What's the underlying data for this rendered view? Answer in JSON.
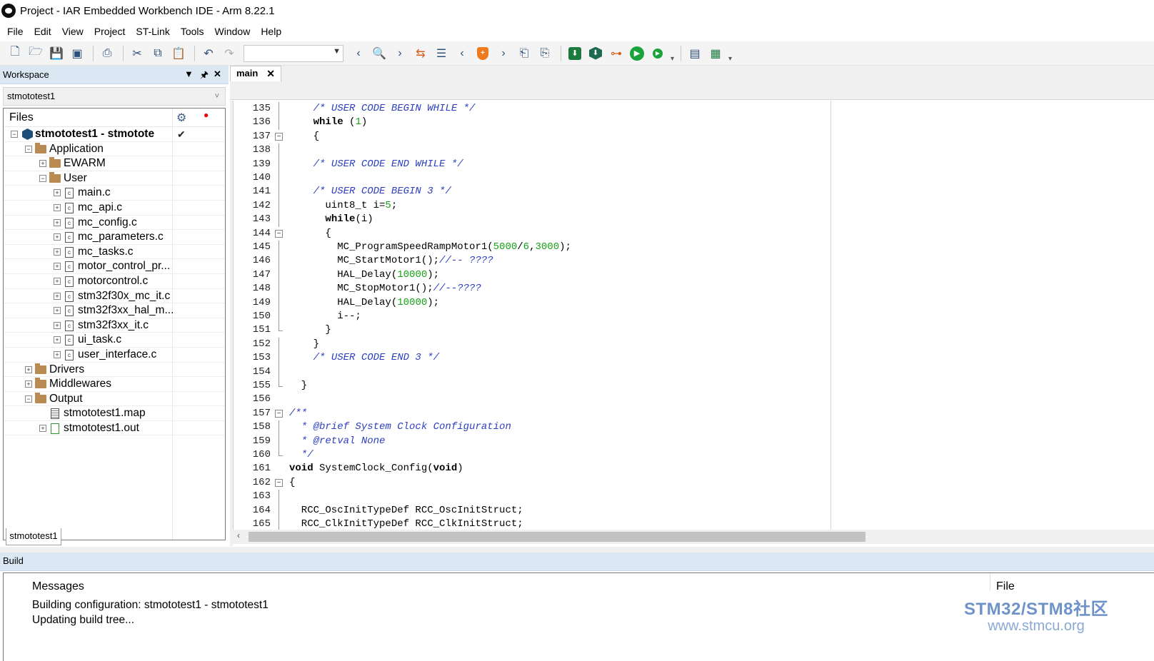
{
  "window": {
    "title": "Project - IAR Embedded Workbench IDE - Arm 8.22.1"
  },
  "menu": [
    "File",
    "Edit",
    "View",
    "Project",
    "ST-Link",
    "Tools",
    "Window",
    "Help"
  ],
  "workspace": {
    "header": "Workspace",
    "config": "stmototest1",
    "files_label": "Files",
    "tab": "stmototest1",
    "tree": [
      {
        "label": "stmototest1 - stmotote",
        "type": "project",
        "level": 0,
        "expander": "−",
        "bold": true
      },
      {
        "label": "Application",
        "type": "folder",
        "level": 1,
        "expander": "−"
      },
      {
        "label": "EWARM",
        "type": "folder",
        "level": 2,
        "expander": "+"
      },
      {
        "label": "User",
        "type": "folder",
        "level": 2,
        "expander": "−"
      },
      {
        "label": "main.c",
        "type": "c",
        "level": 3,
        "expander": "+"
      },
      {
        "label": "mc_api.c",
        "type": "c",
        "level": 3,
        "expander": "+"
      },
      {
        "label": "mc_config.c",
        "type": "c",
        "level": 3,
        "expander": "+"
      },
      {
        "label": "mc_parameters.c",
        "type": "c",
        "level": 3,
        "expander": "+"
      },
      {
        "label": "mc_tasks.c",
        "type": "c",
        "level": 3,
        "expander": "+"
      },
      {
        "label": "motor_control_pr...",
        "type": "c",
        "level": 3,
        "expander": "+"
      },
      {
        "label": "motorcontrol.c",
        "type": "c",
        "level": 3,
        "expander": "+"
      },
      {
        "label": "stm32f30x_mc_it.c",
        "type": "c",
        "level": 3,
        "expander": "+"
      },
      {
        "label": "stm32f3xx_hal_m...",
        "type": "c",
        "level": 3,
        "expander": "+"
      },
      {
        "label": "stm32f3xx_it.c",
        "type": "c",
        "level": 3,
        "expander": "+"
      },
      {
        "label": "ui_task.c",
        "type": "c",
        "level": 3,
        "expander": "+"
      },
      {
        "label": "user_interface.c",
        "type": "c",
        "level": 3,
        "expander": "+"
      },
      {
        "label": "Drivers",
        "type": "folder",
        "level": 1,
        "expander": "+"
      },
      {
        "label": "Middlewares",
        "type": "folder",
        "level": 1,
        "expander": "+"
      },
      {
        "label": "Output",
        "type": "folder",
        "level": 1,
        "expander": "−"
      },
      {
        "label": "stmototest1.map",
        "type": "map",
        "level": 2,
        "expander": ""
      },
      {
        "label": "stmototest1.out",
        "type": "out",
        "level": 2,
        "expander": "+"
      }
    ]
  },
  "editor": {
    "tab": "main",
    "lines": [
      {
        "n": "135",
        "fold": "line",
        "segs": [
          [
            "    ",
            ""
          ],
          [
            "/* USER CODE BEGIN WHILE */",
            "cmt"
          ]
        ]
      },
      {
        "n": "136",
        "fold": "line",
        "segs": [
          [
            "    ",
            ""
          ],
          [
            "while",
            "kw"
          ],
          [
            " (",
            ""
          ],
          [
            "1",
            "num"
          ],
          [
            ")",
            ""
          ]
        ]
      },
      {
        "n": "137",
        "fold": "box",
        "segs": [
          [
            "    {",
            ""
          ]
        ]
      },
      {
        "n": "138",
        "fold": "line",
        "segs": []
      },
      {
        "n": "139",
        "fold": "line",
        "segs": [
          [
            "    ",
            ""
          ],
          [
            "/* USER CODE END WHILE */",
            "cmt"
          ]
        ]
      },
      {
        "n": "140",
        "fold": "line",
        "segs": []
      },
      {
        "n": "141",
        "fold": "line",
        "segs": [
          [
            "    ",
            ""
          ],
          [
            "/* USER CODE BEGIN 3 */",
            "cmt"
          ]
        ]
      },
      {
        "n": "142",
        "fold": "line",
        "segs": [
          [
            "      uint8_t i=",
            ""
          ],
          [
            "5",
            "num"
          ],
          [
            ";",
            ""
          ]
        ]
      },
      {
        "n": "143",
        "fold": "line",
        "segs": [
          [
            "      ",
            ""
          ],
          [
            "while",
            "kw"
          ],
          [
            "(i)",
            ""
          ]
        ]
      },
      {
        "n": "144",
        "fold": "box",
        "segs": [
          [
            "      {",
            ""
          ]
        ]
      },
      {
        "n": "145",
        "fold": "line",
        "segs": [
          [
            "        MC_ProgramSpeedRampMotor1(",
            ""
          ],
          [
            "5000",
            "num"
          ],
          [
            "/",
            ""
          ],
          [
            "6",
            "num"
          ],
          [
            ",",
            ""
          ],
          [
            "3000",
            "num"
          ],
          [
            ");",
            ""
          ]
        ]
      },
      {
        "n": "146",
        "fold": "line",
        "segs": [
          [
            "        MC_StartMotor1();",
            ""
          ],
          [
            "//-- ????",
            "cmt"
          ]
        ]
      },
      {
        "n": "147",
        "fold": "line",
        "segs": [
          [
            "        HAL_Delay(",
            ""
          ],
          [
            "10000",
            "num"
          ],
          [
            ");",
            ""
          ]
        ]
      },
      {
        "n": "148",
        "fold": "line",
        "segs": [
          [
            "        MC_StopMotor1();",
            ""
          ],
          [
            "//--????",
            "cmt"
          ]
        ]
      },
      {
        "n": "149",
        "fold": "line",
        "segs": [
          [
            "        HAL_Delay(",
            ""
          ],
          [
            "10000",
            "num"
          ],
          [
            ");",
            ""
          ]
        ]
      },
      {
        "n": "150",
        "fold": "line",
        "segs": [
          [
            "        i--;",
            ""
          ]
        ]
      },
      {
        "n": "151",
        "fold": "end",
        "segs": [
          [
            "      }",
            ""
          ]
        ]
      },
      {
        "n": "152",
        "fold": "line",
        "segs": [
          [
            "    }",
            ""
          ]
        ]
      },
      {
        "n": "153",
        "fold": "line",
        "segs": [
          [
            "    ",
            ""
          ],
          [
            "/* USER CODE END 3 */",
            "cmt"
          ]
        ]
      },
      {
        "n": "154",
        "fold": "line",
        "segs": []
      },
      {
        "n": "155",
        "fold": "end",
        "segs": [
          [
            "  }",
            ""
          ]
        ]
      },
      {
        "n": "156",
        "fold": "none",
        "segs": []
      },
      {
        "n": "157",
        "fold": "box",
        "segs": [
          [
            "/**",
            "cmt"
          ]
        ]
      },
      {
        "n": "158",
        "fold": "line",
        "segs": [
          [
            "  * @brief System Clock Configuration",
            "cmt"
          ]
        ]
      },
      {
        "n": "159",
        "fold": "line",
        "segs": [
          [
            "  * @retval None",
            "cmt"
          ]
        ]
      },
      {
        "n": "160",
        "fold": "end",
        "segs": [
          [
            "  */",
            "cmt"
          ]
        ]
      },
      {
        "n": "161",
        "fold": "none",
        "segs": [
          [
            "void",
            "kw"
          ],
          [
            " SystemClock_Config(",
            ""
          ],
          [
            "void",
            "kw"
          ],
          [
            ")",
            ""
          ]
        ]
      },
      {
        "n": "162",
        "fold": "box",
        "segs": [
          [
            "{",
            ""
          ]
        ]
      },
      {
        "n": "163",
        "fold": "line",
        "segs": []
      },
      {
        "n": "164",
        "fold": "line",
        "segs": [
          [
            "  RCC_OscInitTypeDef RCC_OscInitStruct;",
            ""
          ]
        ]
      },
      {
        "n": "165",
        "fold": "line",
        "segs": [
          [
            "  RCC_ClkInitTypeDef RCC_ClkInitStruct;",
            ""
          ]
        ]
      }
    ]
  },
  "build": {
    "header": "Build",
    "col_messages": "Messages",
    "col_file": "File",
    "messages": [
      "Building configuration: stmototest1 - stmototest1",
      "Updating build tree..."
    ]
  },
  "watermark": {
    "line1": "STM32/STM8社区",
    "line2": "www.stmcu.org"
  },
  "colors": {
    "comment": "#2c3fbf",
    "number": "#17a117",
    "panel_header": "#dbe8f4",
    "run_green": "#1aa23b"
  }
}
